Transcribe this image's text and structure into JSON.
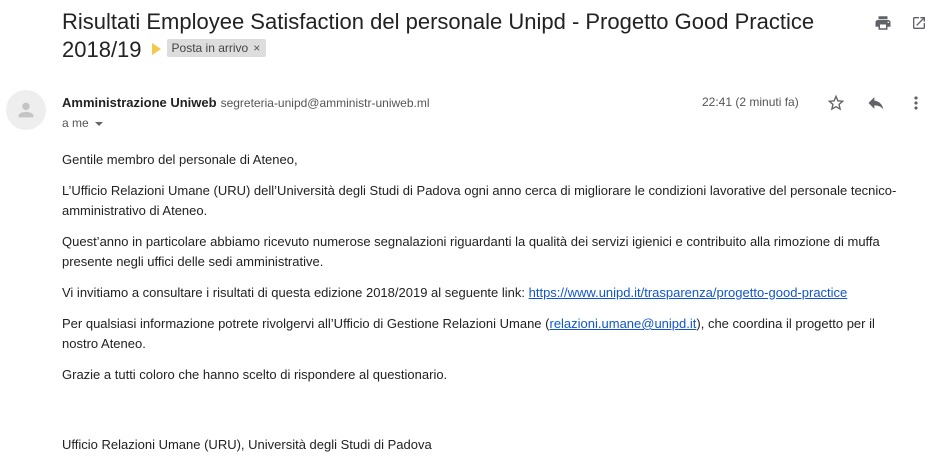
{
  "email": {
    "subject": "Risultati Employee Satisfaction del personale Unipd - Progetto Good Practice 2018/19",
    "label": "Posta in arrivo",
    "label_remove": "×",
    "sender_name": "Amministrazione Uniweb",
    "sender_email": "segreteria-unipd@amministr-uniweb.ml",
    "recipient": "a me",
    "time": "22:41 (2 minuti fa)",
    "icons": {
      "print": "print-icon",
      "open_new_window": "open-in-new-window-icon",
      "star": "star-icon",
      "reply": "reply-icon",
      "more": "more-vert-icon",
      "avatar": "person-icon"
    },
    "body": {
      "greeting": "Gentile membro del personale di Ateneo,",
      "p1": "L’Ufficio Relazioni Umane (URU) dell’Università degli Studi di Padova ogni anno cerca di migliorare le condizioni lavorative del personale tecnico-amministrativo di Ateneo.",
      "p2": "Quest’anno in particolare abbiamo ricevuto numerose segnalazioni riguardanti la qualità dei servizi igienici e contribuito alla rimozione di muffa presente negli uffici delle sedi amministrative.",
      "p3_text": "Vi invitiamo a consultare i risultati di questa edizione 2018/2019 al seguente link: ",
      "p3_link": "https://www.unipd.it/trasparenza/progetto-good-practice",
      "p4_before": "Per qualsiasi informazione potrete rivolgervi all’Ufficio di Gestione Relazioni Umane (",
      "p4_link": "relazioni.umane@unipd.it",
      "p4_after": "), che coordina il progetto per il nostro Ateneo.",
      "p5": "Grazie a tutti coloro che hanno scelto di rispondere al questionario."
    },
    "signature": "Ufficio Relazioni Umane (URU), Università degli Studi di Padova"
  },
  "colors": {
    "label_arrow": "#f2c94c",
    "link": "#1155cc",
    "label_bg": "#dddddd"
  }
}
